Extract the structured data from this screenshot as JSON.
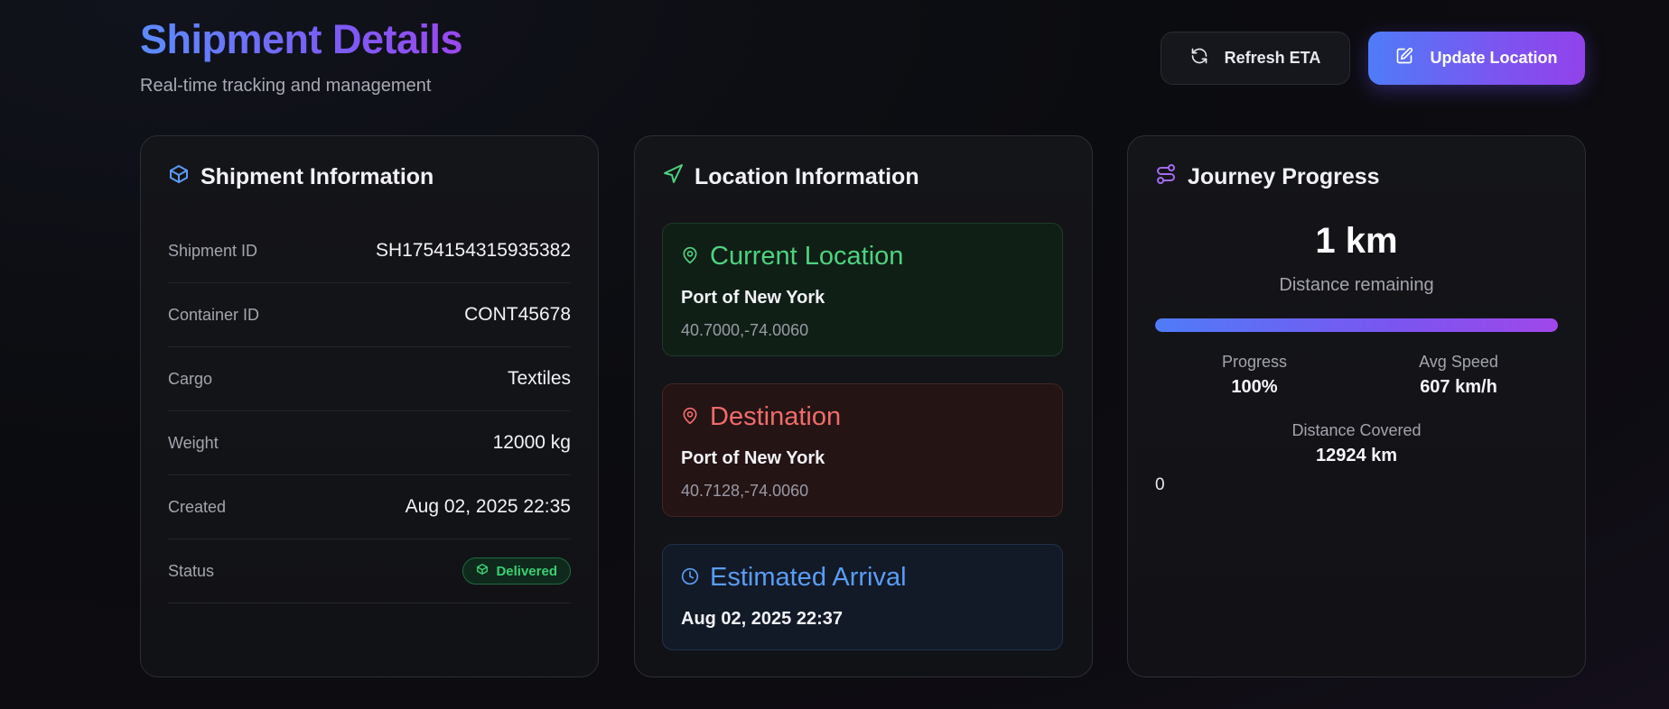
{
  "header": {
    "title": "Shipment Details",
    "subtitle": "Real-time tracking and management",
    "refresh_label": "Refresh ETA",
    "update_label": "Update Location"
  },
  "shipment_info": {
    "heading": "Shipment Information",
    "rows": [
      {
        "label": "Shipment ID",
        "value": "SH1754154315935382"
      },
      {
        "label": "Container ID",
        "value": "CONT45678"
      },
      {
        "label": "Cargo",
        "value": "Textiles"
      },
      {
        "label": "Weight",
        "value": "12000 kg"
      },
      {
        "label": "Created",
        "value": "Aug 02, 2025 22:35"
      }
    ],
    "status_label": "Status",
    "status_value": "Delivered"
  },
  "location_info": {
    "heading": "Location Information",
    "current": {
      "title": "Current Location",
      "name": "Port of New York",
      "coords": "40.7000,-74.0060"
    },
    "destination": {
      "title": "Destination",
      "name": "Port of New York",
      "coords": "40.7128,-74.0060"
    },
    "eta": {
      "title": "Estimated Arrival",
      "value": "Aug 02, 2025 22:37"
    }
  },
  "journey": {
    "heading": "Journey Progress",
    "distance_remaining": "1 km",
    "distance_remaining_label": "Distance remaining",
    "progress_fraction": 1.0,
    "progress_label": "Progress",
    "progress_value": "100%",
    "speed_label": "Avg Speed",
    "speed_value": "607 km/h",
    "covered_label": "Distance Covered",
    "covered_value": "12924 km",
    "stray_text": "0"
  },
  "colors": {
    "accent_blue": "#4f7cf8",
    "accent_purple": "#9242ea",
    "status_green": "#3ccf73",
    "destination_red": "#f26b6b",
    "eta_blue": "#5a9cf5"
  },
  "icons": {
    "refresh": "refresh-icon",
    "edit": "edit-icon",
    "box": "box-icon",
    "navigation": "navigation-icon",
    "route": "route-icon",
    "map_pin": "map-pin-icon",
    "clock": "clock-icon"
  }
}
